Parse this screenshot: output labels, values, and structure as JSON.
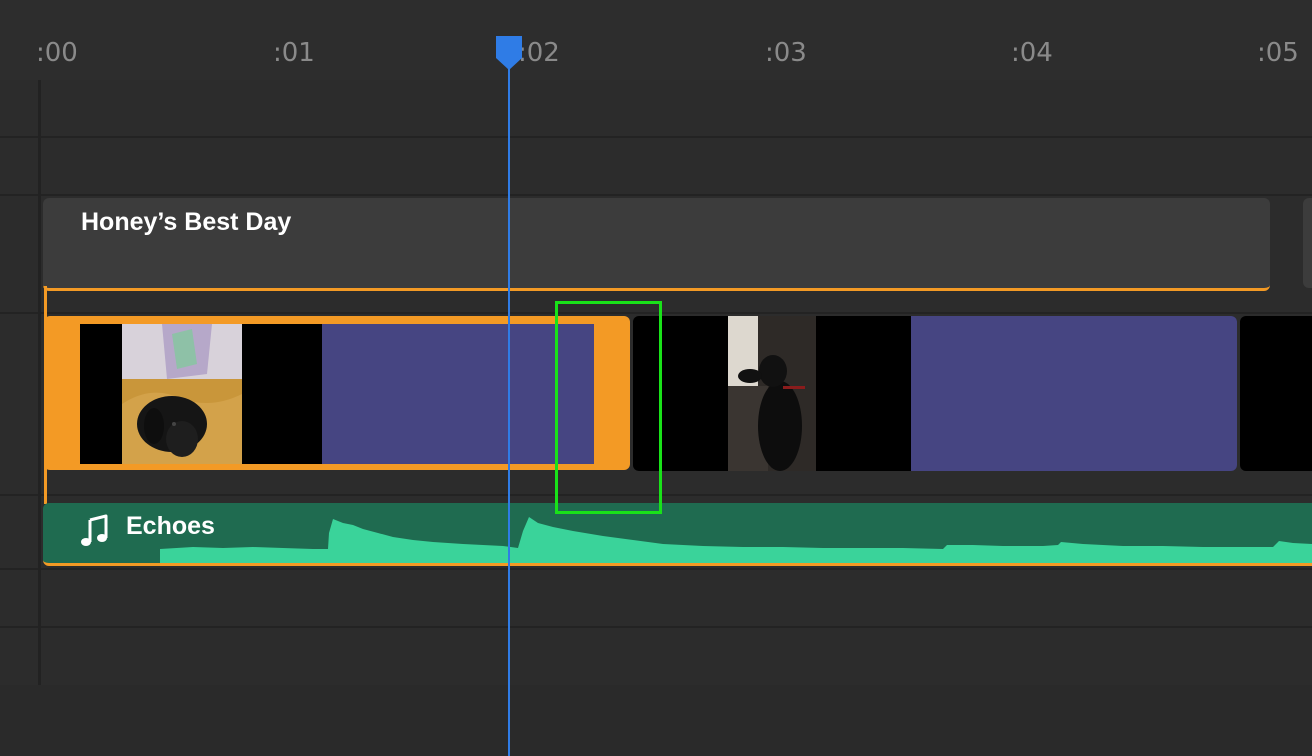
{
  "ruler": {
    "ticks": [
      ":00",
      ":01",
      ":02",
      ":03",
      ":04",
      ":05"
    ]
  },
  "title_clip": {
    "label": "Honey’s Best Day"
  },
  "audio_clip": {
    "label": "Echoes",
    "icon": "music-note-icon"
  },
  "colors": {
    "selection": "#f39a25",
    "playhead": "#2f7ce6",
    "audio_track": "#1f6b50",
    "waveform": "#3ad39a",
    "clip_fill": "#464582",
    "highlight_box": "#19e219"
  }
}
